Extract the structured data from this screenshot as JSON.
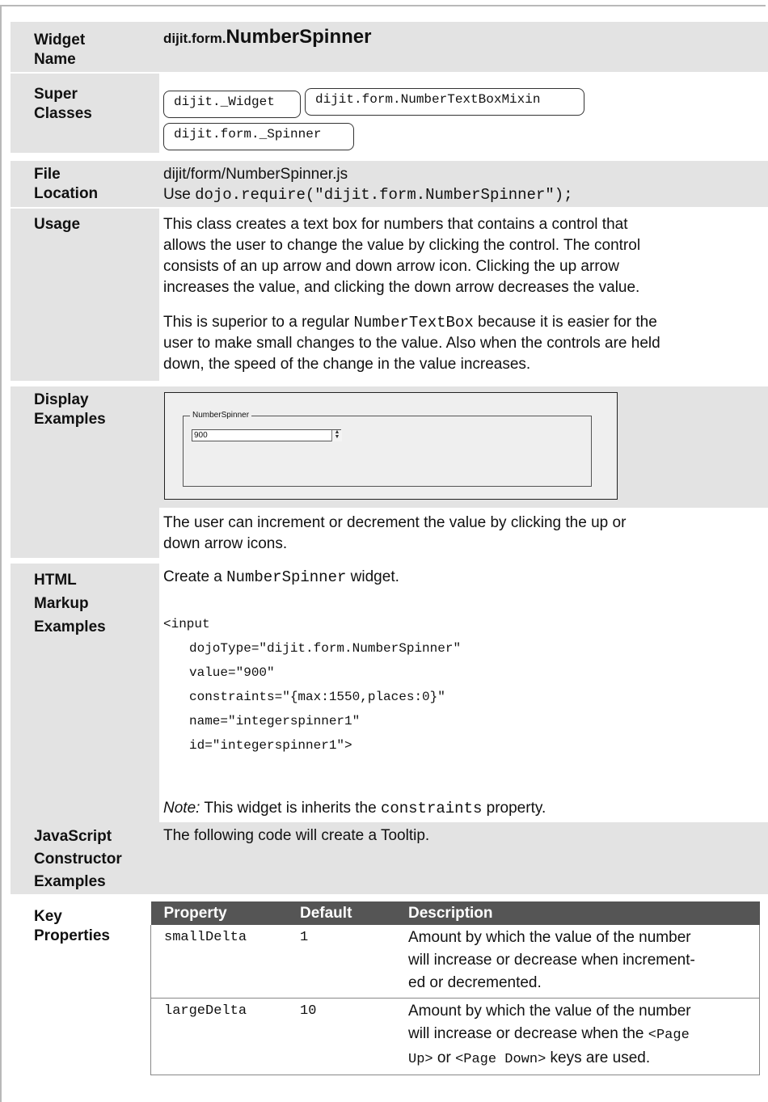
{
  "rows": {
    "widget_name": {
      "label": [
        "Widget",
        "Name"
      ],
      "prefix": "dijit.form.",
      "name": "NumberSpinner"
    },
    "super_classes": {
      "label": [
        "Super",
        "Classes"
      ],
      "classes": [
        "dijit._Widget",
        "dijit.form.NumberTextBoxMixin",
        "dijit.form._Spinner"
      ]
    },
    "file_location": {
      "label": [
        "File",
        "Location"
      ],
      "path": "dijit/form/NumberSpinner.js",
      "use_prefix": "Use ",
      "require": "dojo.require(\"dijit.form.NumberSpinner\");"
    },
    "usage": {
      "label": [
        "Usage"
      ],
      "para1": [
        "This class creates a text box for numbers that contains a control that",
        "allows the user to change the value by clicking the control. The control",
        "consists of an up arrow and down arrow icon. Clicking the up arrow",
        "increases the value, and clicking the down arrow decreases the value."
      ],
      "para2": {
        "a": "This is superior to a regular ",
        "code": "NumberTextBox",
        "b": " because it is easier for the",
        "line2": "user to make small changes to the value. Also when the controls are held",
        "line3": "down, the speed of the change in the value increases."
      }
    },
    "display_examples": {
      "label": [
        "Display",
        "Examples"
      ],
      "legend": "NumberSpinner",
      "input_value": "900",
      "caption": [
        "The user can increment or decrement the value by clicking the up or",
        "down arrow icons."
      ]
    },
    "html_markup": {
      "label": [
        "HTML",
        "Markup",
        "Examples"
      ],
      "intro_a": "Create a ",
      "intro_code": "NumberSpinner",
      "intro_b": " widget.",
      "code": [
        "<input",
        "dojoType=\"dijit.form.NumberSpinner\"",
        "value=\"900\"",
        "constraints=\"{max:1550,places:0}\"",
        "name=\"integerspinner1\"",
        "id=\"integerspinner1\">"
      ],
      "note_label": "Note:",
      "note_a": " This widget is inherits the ",
      "note_code": "constraints",
      "note_b": " property."
    },
    "js_constructor": {
      "label": [
        "JavaScript",
        "Constructor",
        "Examples"
      ],
      "text": "The following code will create a Tooltip."
    },
    "key_properties": {
      "label": [
        "Key",
        "Properties"
      ],
      "headers": [
        "Property",
        "Default",
        "Description"
      ],
      "items": [
        {
          "property": "smallDelta",
          "default": "1",
          "desc": [
            "Amount by which the value of the number",
            "will increase or decrease when increment-",
            "ed or decremented."
          ]
        },
        {
          "property": "largeDelta",
          "default": "10",
          "desc_a": "Amount by which the value of the number",
          "desc_b": "will increase or decrease when the ",
          "code1": "<Page",
          "code2": "Up>",
          "desc_c": " or ",
          "code3": "<Page Down>",
          "desc_d": " keys are used."
        }
      ]
    }
  }
}
